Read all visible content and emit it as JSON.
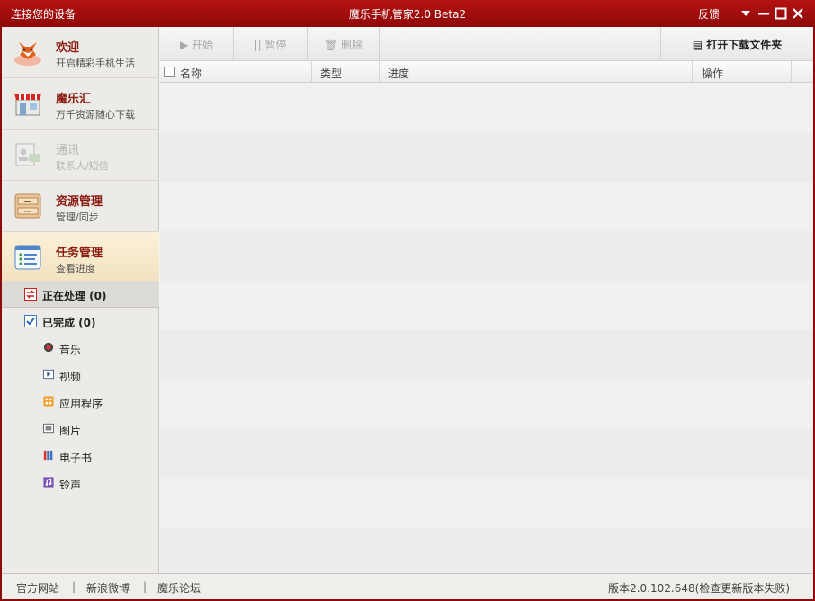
{
  "titlebar": {
    "left_title": "连接您的设备",
    "title": "魔乐手机管家2.0 Beta2",
    "feedback": "反馈"
  },
  "sidebar": {
    "nav": [
      {
        "title": "欢迎",
        "subtitle": "开启精彩手机生活",
        "icon": "fox-icon",
        "state": "normal"
      },
      {
        "title": "魔乐汇",
        "subtitle": "万千资源随心下载",
        "icon": "store-icon",
        "state": "normal"
      },
      {
        "title": "通讯",
        "subtitle": "联系人/短信",
        "icon": "contacts-icon",
        "state": "disabled"
      },
      {
        "title": "资源管理",
        "subtitle": "管理/同步",
        "icon": "cabinet-icon",
        "state": "normal"
      },
      {
        "title": "任务管理",
        "subtitle": "查看进度",
        "icon": "task-list-icon",
        "state": "active"
      }
    ],
    "tasks": {
      "processing": "正在处理 (0)",
      "completed": "已完成 (0)",
      "categories": [
        {
          "label": "音乐",
          "icon": "music-icon"
        },
        {
          "label": "视频",
          "icon": "video-icon"
        },
        {
          "label": "应用程序",
          "icon": "app-icon"
        },
        {
          "label": "图片",
          "icon": "picture-icon"
        },
        {
          "label": "电子书",
          "icon": "ebook-icon"
        },
        {
          "label": "铃声",
          "icon": "ringtone-icon"
        }
      ]
    }
  },
  "toolbar": {
    "start": "开始",
    "pause": "暂停",
    "delete": "删除",
    "open_folder": "打开下载文件夹"
  },
  "table": {
    "columns": [
      "名称",
      "类型",
      "进度",
      "操作"
    ],
    "rows": []
  },
  "footer": {
    "links": [
      "官方网站",
      "新浪微博",
      "魔乐论坛"
    ],
    "version": "版本2.0.102.648(检查更新版本失败)"
  },
  "colors": {
    "titlebar": "#a00f0f",
    "accent_text": "#8b1a10",
    "active_nav": "#f6e8c9"
  }
}
